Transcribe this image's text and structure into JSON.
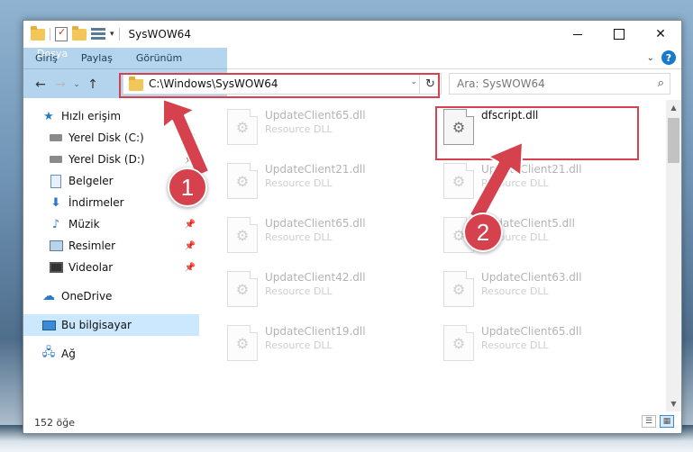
{
  "window": {
    "title": "SysWOW64"
  },
  "ribbon": {
    "tabs": [
      "Dosya",
      "Giriş",
      "Paylaş",
      "Görünüm"
    ],
    "help": "?"
  },
  "address": {
    "path": "C:\\Windows\\SysWOW64"
  },
  "search": {
    "placeholder": "Ara: SysWOW64"
  },
  "sidebar": {
    "items": [
      {
        "label": "Hızlı erişim"
      },
      {
        "label": "Yerel Disk (C:)"
      },
      {
        "label": "Yerel Disk (D:)"
      },
      {
        "label": "Belgeler"
      },
      {
        "label": "İndirmeler"
      },
      {
        "label": "Müzik"
      },
      {
        "label": "Resimler"
      },
      {
        "label": "Videolar"
      },
      {
        "label": "OneDrive"
      },
      {
        "label": "Bu bilgisayar"
      },
      {
        "label": "Ağ"
      }
    ]
  },
  "files": [
    {
      "name": "UpdateClient65.dll",
      "type": "Resource DLL"
    },
    {
      "name": "dfscript.dll",
      "type": ""
    },
    {
      "name": "UpdateClient21.dll",
      "type": "Resource DLL"
    },
    {
      "name": "UpdateClient21.dll",
      "type": "Resource DLL"
    },
    {
      "name": "UpdateClient65.dll",
      "type": "Resource DLL"
    },
    {
      "name": "UpdateClient5.dll",
      "type": "Resource DLL"
    },
    {
      "name": "UpdateClient42.dll",
      "type": "Resource DLL"
    },
    {
      "name": "UpdateClient63.dll",
      "type": "Resource DLL"
    },
    {
      "name": "UpdateClient19.dll",
      "type": "Resource DLL"
    },
    {
      "name": "UpdateClient65.dll",
      "type": "Resource DLL"
    }
  ],
  "status": {
    "count": "152 öğe"
  },
  "annotations": {
    "badge1": "1",
    "badge2": "2",
    "color": "#d6414e"
  },
  "colors": {
    "accent": "#1979ca",
    "selected": "#cce8ff"
  }
}
